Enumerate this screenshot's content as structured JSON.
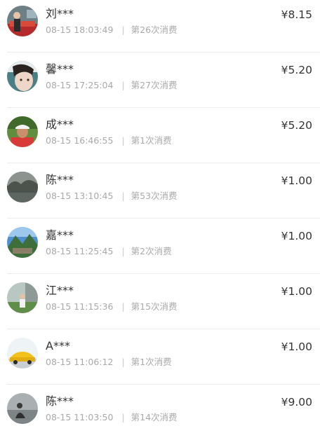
{
  "records": [
    {
      "name": "刘***",
      "time": "08-15 18:03:49",
      "count": "第26次消费",
      "amount": "¥8.15",
      "avatar": "avatar-person-in-front-of-red-car"
    },
    {
      "name": "馨***",
      "time": "08-15 17:25:04",
      "count": "第27次消费",
      "amount": "¥5.20",
      "avatar": "avatar-woman-face-closeup"
    },
    {
      "name": "成***",
      "time": "08-15 16:46:55",
      "count": "第1次消费",
      "amount": "¥5.20",
      "avatar": "avatar-man-in-red-shirt-and-cap"
    },
    {
      "name": "陈***",
      "time": "08-15 13:10:45",
      "count": "第53次消费",
      "amount": "¥1.00",
      "avatar": "avatar-river-landscape-dark"
    },
    {
      "name": "嘉***",
      "time": "08-15 11:25:45",
      "count": "第2次消费",
      "amount": "¥1.00",
      "avatar": "avatar-mountain-ruins-landscape"
    },
    {
      "name": "江***",
      "time": "08-15 11:15:36",
      "count": "第15次消费",
      "amount": "¥1.00",
      "avatar": "avatar-person-by-building"
    },
    {
      "name": "A***",
      "time": "08-15 11:06:12",
      "count": "第1次消费",
      "amount": "¥1.00",
      "avatar": "avatar-yellow-sports-car"
    },
    {
      "name": "陈***",
      "time": "08-15 11:03:50",
      "count": "第14次消费",
      "amount": "¥9.00",
      "avatar": "avatar-person-by-water"
    }
  ]
}
